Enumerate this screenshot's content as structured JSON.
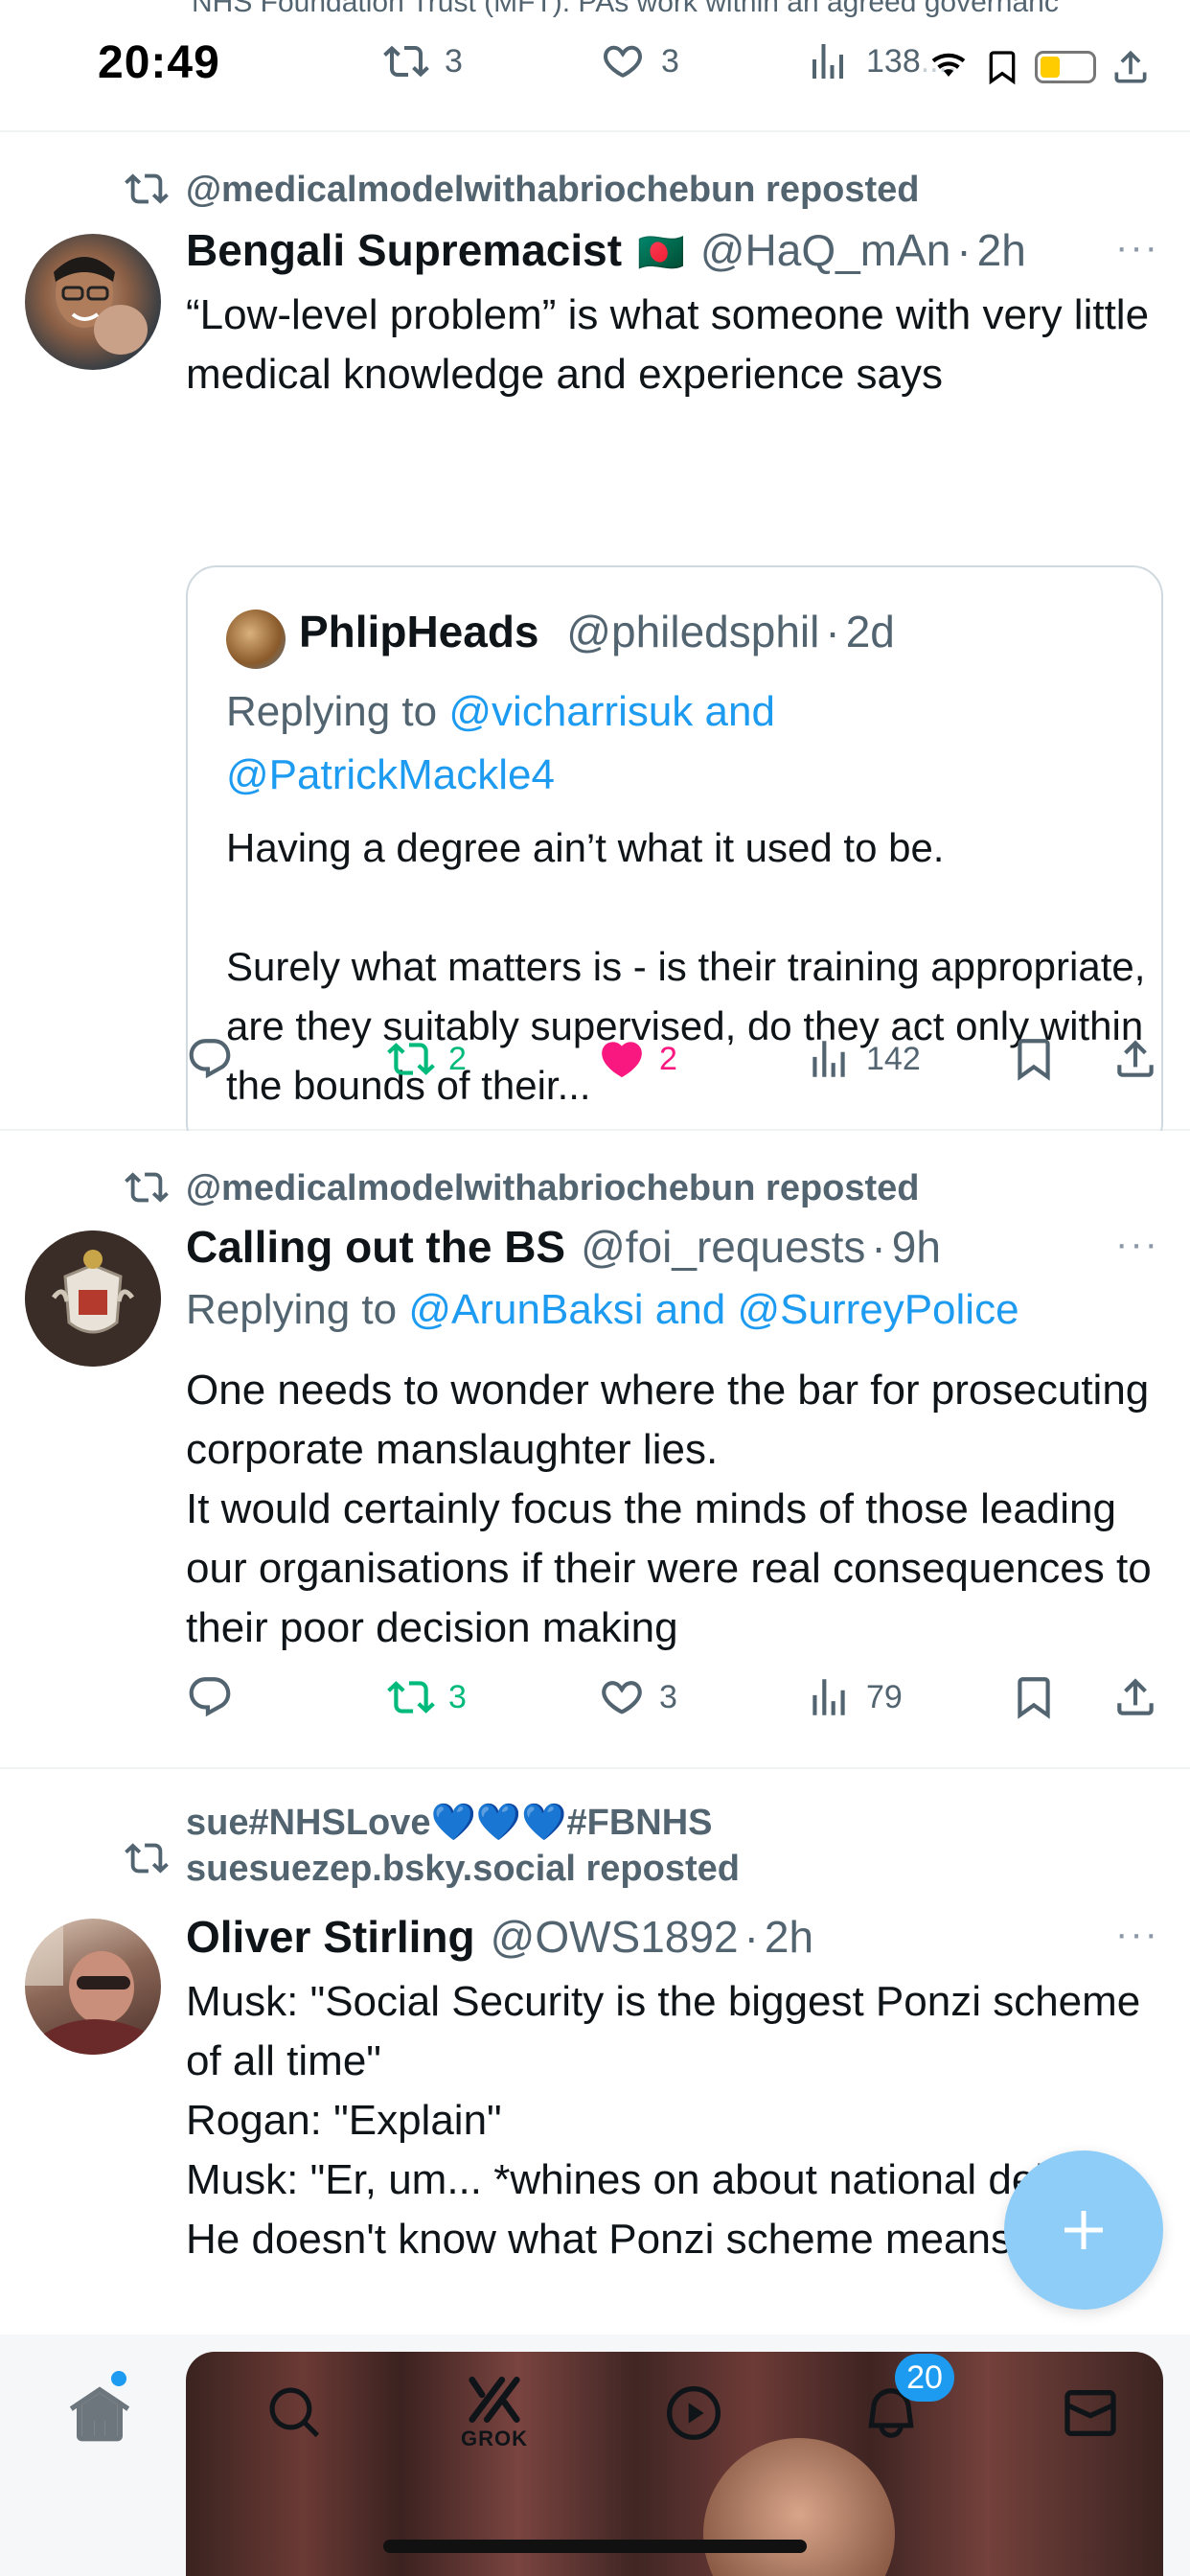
{
  "status": {
    "time": "20:49",
    "cut_text": "NHS Foundation Trust (MFT). PAs work within an agreed governanc"
  },
  "top_actions": {
    "retweets": "3",
    "likes": "3",
    "views": "138"
  },
  "tweets": [
    {
      "reposted_by": "@medicalmodelwithabriochebun reposted",
      "name": "Bengali Supremacist",
      "flag": "🇧🇩",
      "handle": "@HaQ_mAn",
      "time": "2h",
      "text": "“Low-level problem” is what someone with very little medical knowledge and experience says",
      "quote": {
        "name": "PhlipHeads",
        "handle": "@philedsphil",
        "time": "2d",
        "replying_label": "Replying to",
        "replying_to": "@vicharrisuk and @PatrickMackle4",
        "text": "Having a degree ain’t what it used to be.\n\nSurely what matters is - is their training appropriate, are they suitably supervised, do they act only within the bounds of their..."
      },
      "actions": {
        "replies": "",
        "retweets": "2",
        "likes": "2",
        "views": "142"
      }
    },
    {
      "reposted_by": "@medicalmodelwithabriochebun reposted",
      "name": "Calling out the BS",
      "handle": "@foi_requests",
      "time": "9h",
      "replying_label": "Replying to",
      "replying_to": "@ArunBaksi and @SurreyPolice",
      "text": "One needs to wonder where the bar for prosecuting corporate manslaughter lies.\nIt would certainly focus the minds of those leading our organisations if their were real consequences to their poor decision making",
      "actions": {
        "replies": "",
        "retweets": "3",
        "likes": "3",
        "views": "79"
      }
    },
    {
      "reposted_by_line1": "sue#NHSLove💙💙💙#FBNHS",
      "reposted_by_line2": "suesuezep.bsky.social reposted",
      "name": "Oliver Stirling",
      "handle": "@OWS1892",
      "time": "2h",
      "text": "Musk: \"Social Security is the biggest Ponzi scheme of all time\"\nRogan: \"Explain\"\nMusk: \"Er, um... *whines on about national debt*\"\nHe doesn't know what Ponzi scheme means."
    }
  ],
  "nav": {
    "grok_label": "GROK",
    "notifications_badge": "20"
  },
  "dot": "·",
  "more": "···",
  "colors": {
    "accent": "#1d9bf0",
    "green": "#00ba7c",
    "pink": "#f91880",
    "muted": "#536471"
  }
}
